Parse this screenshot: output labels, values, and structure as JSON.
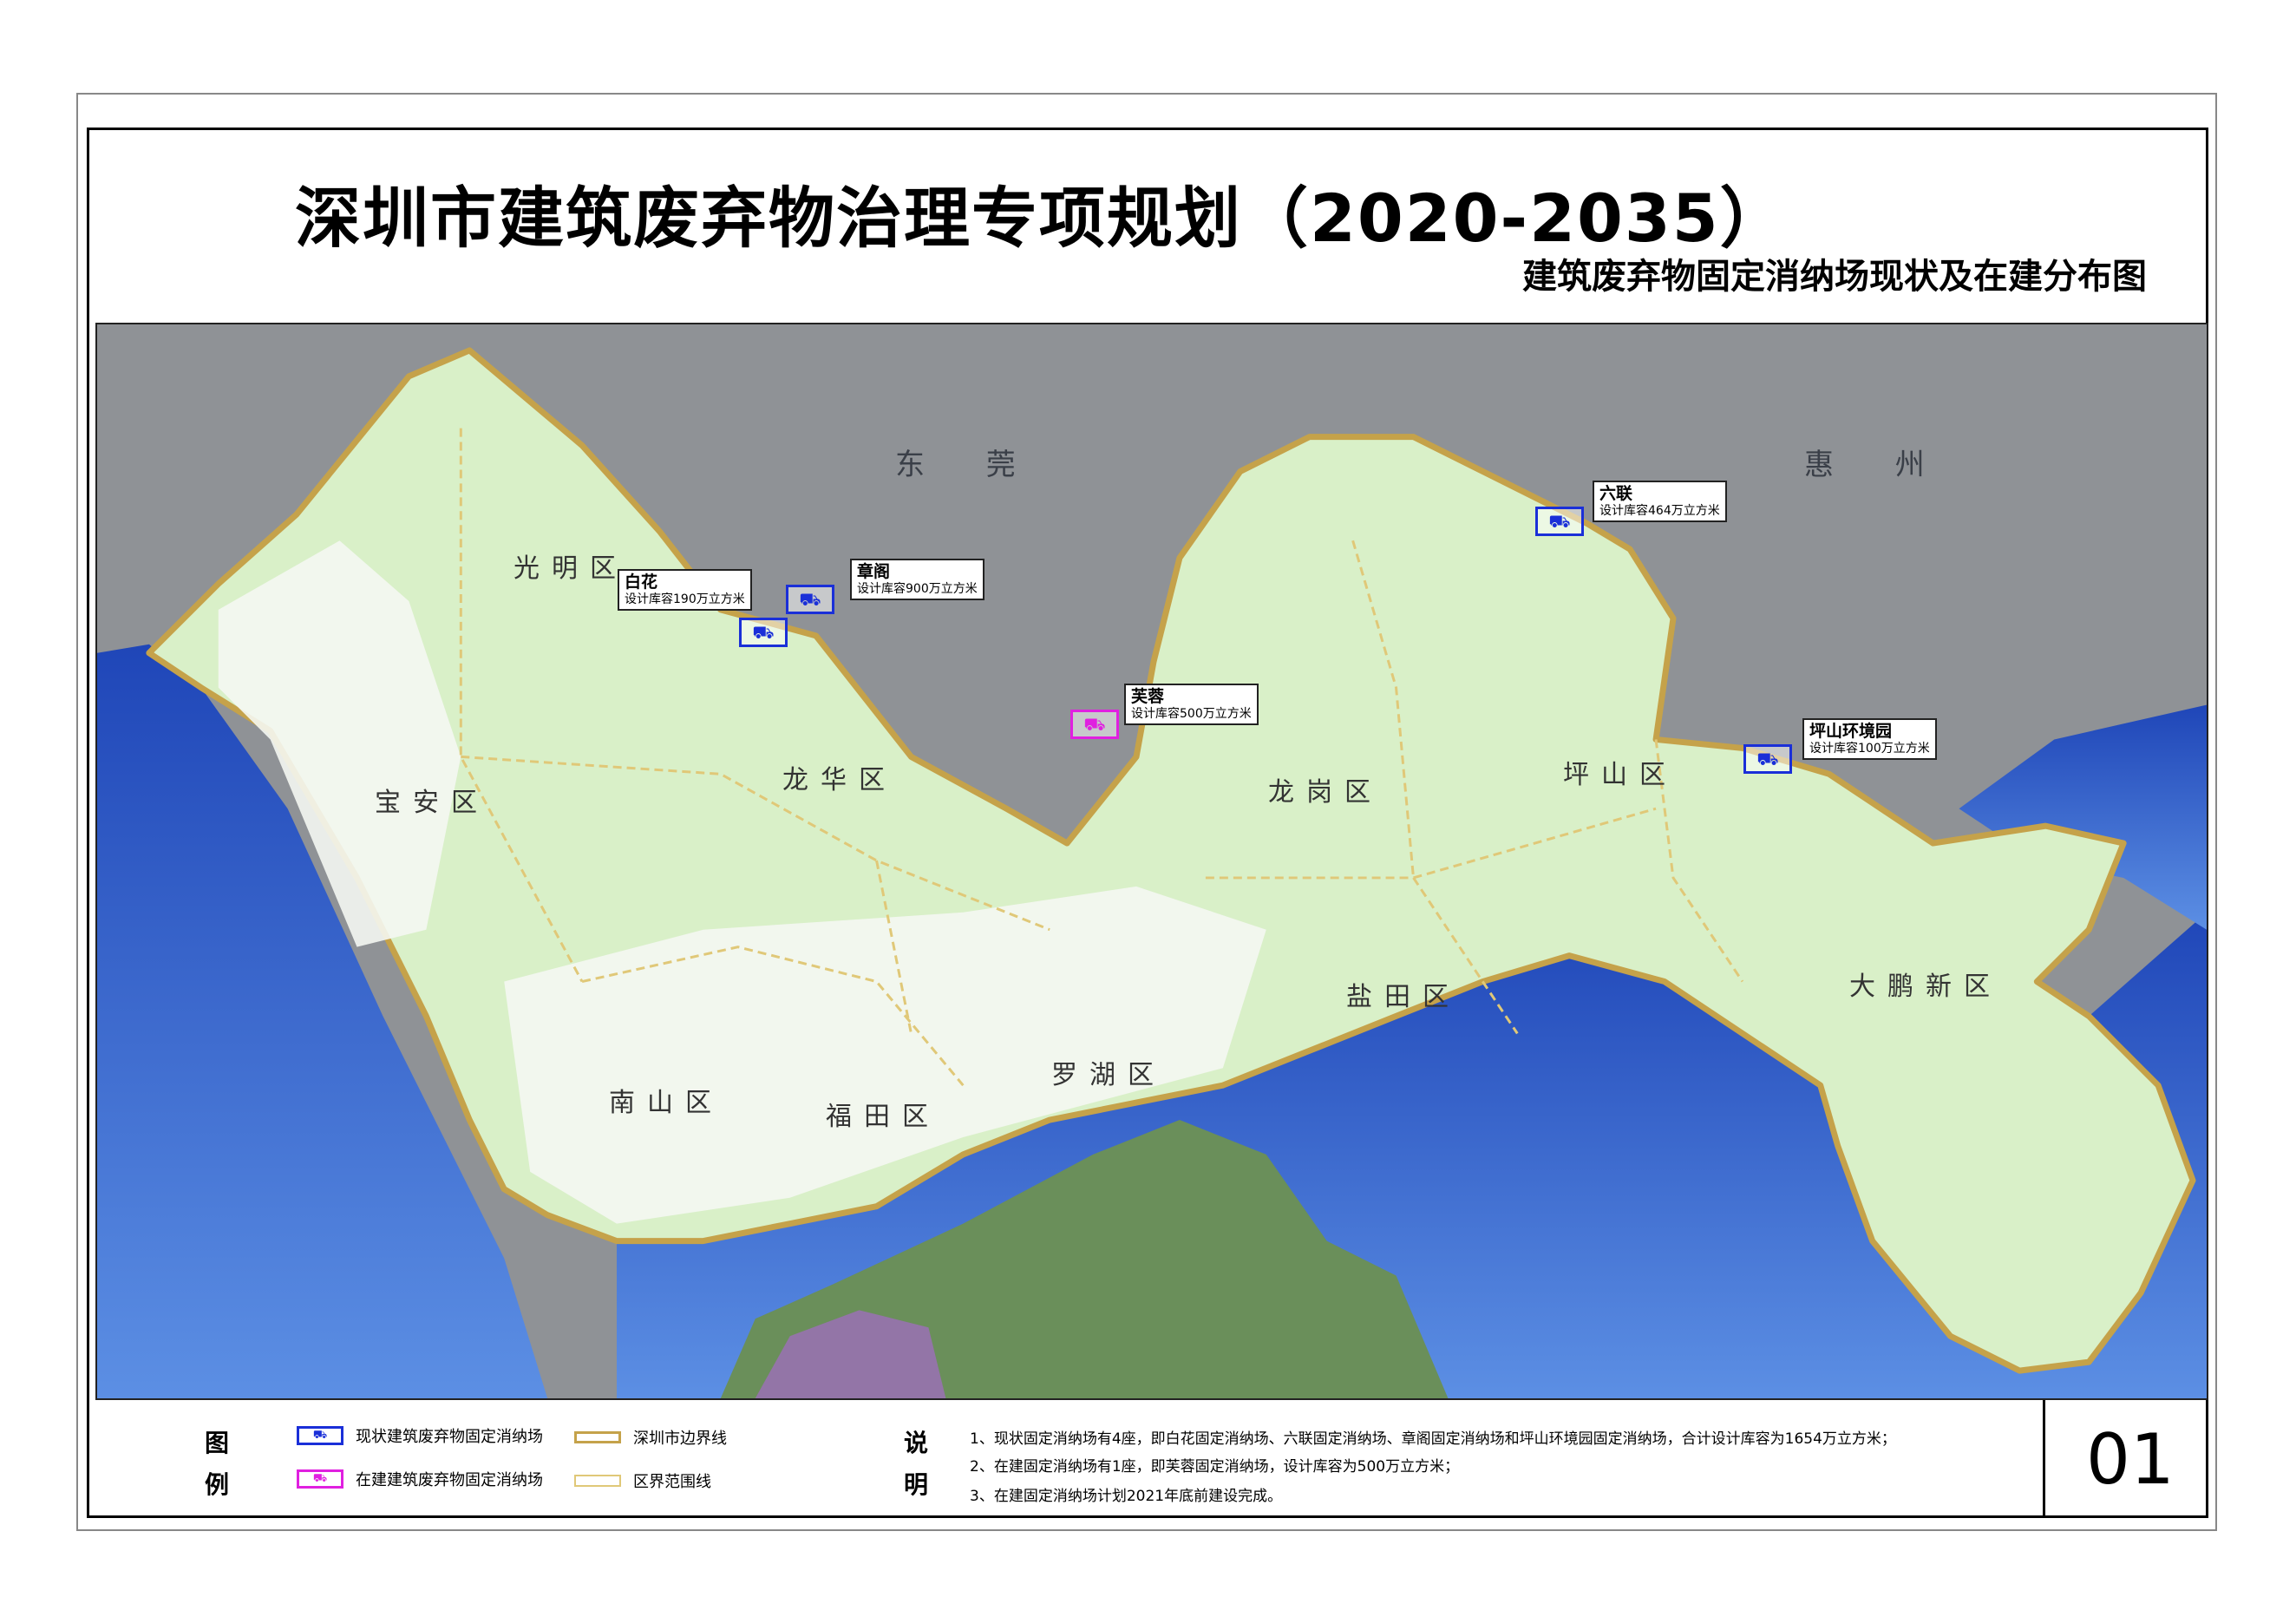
{
  "title": "深圳市建筑废弃物治理专项规划（2020-2035）",
  "subtitle": "建筑废弃物固定消纳场现状及在建分布图",
  "cities": [
    "东 莞",
    "惠 州"
  ],
  "districts": [
    "光明区",
    "宝安区",
    "龙华区",
    "龙岗区",
    "坪山区",
    "盐田区",
    "大鹏新区",
    "罗湖区",
    "福田区",
    "南山区"
  ],
  "sites": [
    {
      "name": "白花",
      "capacity": "设计库容190万立方米",
      "status": "existing"
    },
    {
      "name": "章阁",
      "capacity": "设计库容900万立方米",
      "status": "existing"
    },
    {
      "name": "六联",
      "capacity": "设计库容464万立方米",
      "status": "existing"
    },
    {
      "name": "芙蓉",
      "capacity": "设计库容500万立方米",
      "status": "under-construction"
    },
    {
      "name": "坪山环境园",
      "capacity": "设计库容100万立方米",
      "status": "existing"
    }
  ],
  "legend": {
    "heading_1": "图",
    "heading_2": "例",
    "items": [
      {
        "label": "现状建筑废弃物固定消纳场",
        "color": "#1a2fd8"
      },
      {
        "label": "在建建筑废弃物固定消纳场",
        "color": "#e020e0"
      },
      {
        "label": "深圳市边界线",
        "color": "#c5a24a"
      },
      {
        "label": "区界范围线",
        "color": "#e0c878"
      }
    ]
  },
  "notes": {
    "heading_1": "说",
    "heading_2": "明",
    "items": [
      "1、现状固定消纳场有4座，即白花固定消纳场、六联固定消纳场、章阁固定消纳场和坪山环境园固定消纳场，合计设计库容为1654万立方米；",
      "2、在建固定消纳场有1座，即芙蓉固定消纳场，设计库容为500万立方米；",
      "3、在建固定消纳场计划2021年底前建设完成。"
    ]
  },
  "sheet_number": "01",
  "colors": {
    "land": "#d9f0c8",
    "urban": "#f4f7f2",
    "sea": "#2f5fc9",
    "terrain": "#8f9296",
    "city_boundary": "#c5a24a",
    "district_boundary": "#e0c878",
    "existing_site": "#1a2fd8",
    "construction_site": "#e020e0"
  }
}
